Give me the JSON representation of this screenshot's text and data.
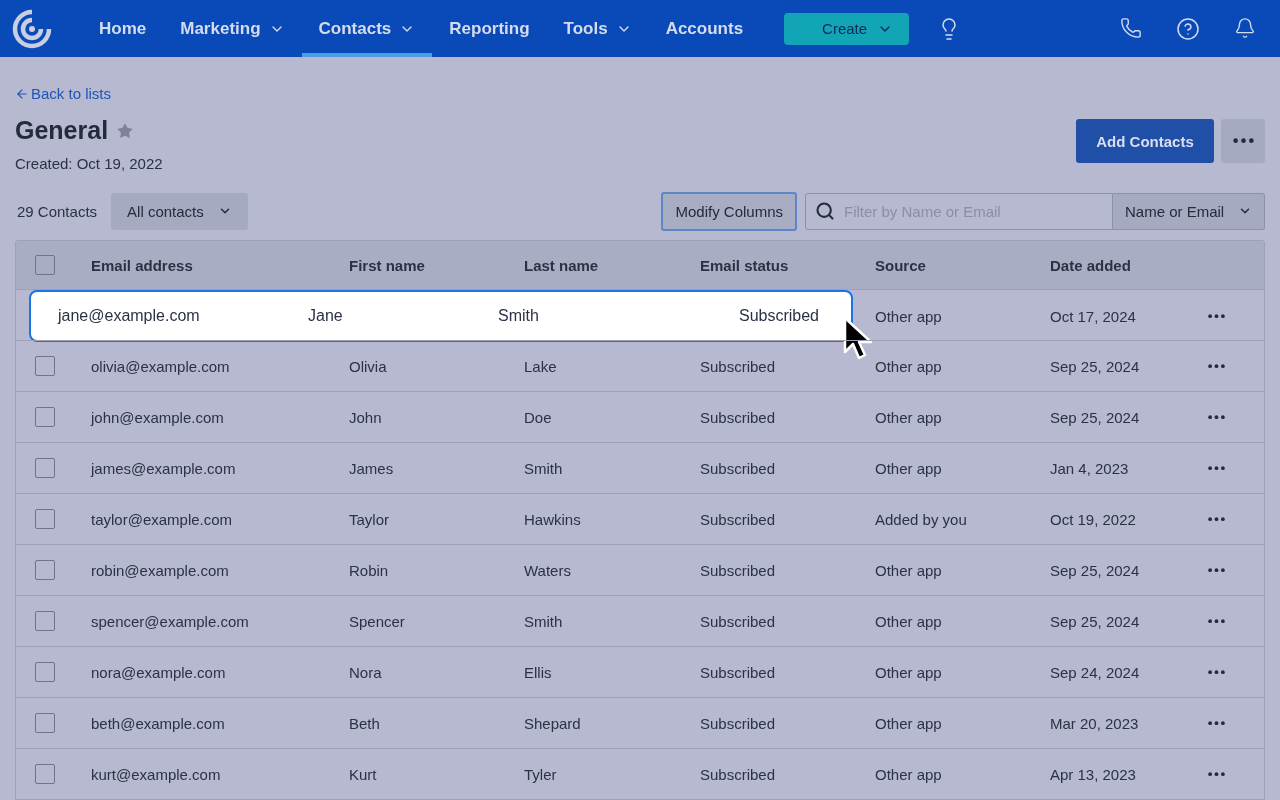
{
  "nav": {
    "items": [
      {
        "label": "Home",
        "dropdown": false,
        "selected": false
      },
      {
        "label": "Marketing",
        "dropdown": true,
        "selected": false
      },
      {
        "label": "Contacts",
        "dropdown": true,
        "selected": true
      },
      {
        "label": "Reporting",
        "dropdown": false,
        "selected": false
      },
      {
        "label": "Tools",
        "dropdown": true,
        "selected": false
      },
      {
        "label": "Accounts",
        "dropdown": false,
        "selected": false
      }
    ],
    "create_button": "Create"
  },
  "back_link": "Back to lists",
  "list": {
    "title": "General",
    "starred": false,
    "created": "Created: Oct 19, 2022"
  },
  "add_contacts_button": "Add Contacts",
  "toolbar": {
    "count": "29 Contacts",
    "segment": "All contacts",
    "modify_columns": "Modify Columns",
    "search": {
      "placeholder": "Filter by Name or Email"
    },
    "search_scope": "Name or Email"
  },
  "table": {
    "select_all_checked": false,
    "columns": [
      "Email address",
      "First name",
      "Last name",
      "Email status",
      "Source",
      "Date added"
    ],
    "rows": [
      {
        "email": "jane@example.com",
        "first": "Jane",
        "last": "Smith",
        "status": "Subscribed",
        "source": "Other app",
        "date": "Oct 17, 2024",
        "checked": false,
        "highlighted": true
      },
      {
        "email": "olivia@example.com",
        "first": "Olivia",
        "last": "Lake",
        "status": "Subscribed",
        "source": "Other app",
        "date": "Sep 25, 2024",
        "checked": false,
        "highlighted": false
      },
      {
        "email": "john@example.com",
        "first": "John",
        "last": "Doe",
        "status": "Subscribed",
        "source": "Other app",
        "date": "Sep 25, 2024",
        "checked": false,
        "highlighted": false
      },
      {
        "email": "james@example.com",
        "first": "James",
        "last": "Smith",
        "status": "Subscribed",
        "source": "Other app",
        "date": "Jan 4, 2023",
        "checked": false,
        "highlighted": false
      },
      {
        "email": "taylor@example.com",
        "first": "Taylor",
        "last": "Hawkins",
        "status": "Subscribed",
        "source": "Added by you",
        "date": "Oct 19, 2022",
        "checked": false,
        "highlighted": false
      },
      {
        "email": "robin@example.com",
        "first": "Robin",
        "last": "Waters",
        "status": "Subscribed",
        "source": "Other app",
        "date": "Sep 25, 2024",
        "checked": false,
        "highlighted": false
      },
      {
        "email": "spencer@example.com",
        "first": "Spencer",
        "last": "Smith",
        "status": "Subscribed",
        "source": "Other app",
        "date": "Sep 25, 2024",
        "checked": false,
        "highlighted": false
      },
      {
        "email": "nora@example.com",
        "first": "Nora",
        "last": "Ellis",
        "status": "Subscribed",
        "source": "Other app",
        "date": "Sep 24, 2024",
        "checked": false,
        "highlighted": false
      },
      {
        "email": "beth@example.com",
        "first": "Beth",
        "last": "Shepard",
        "status": "Subscribed",
        "source": "Other app",
        "date": "Mar 20, 2023",
        "checked": false,
        "highlighted": false
      },
      {
        "email": "kurt@example.com",
        "first": "Kurt",
        "last": "Tyler",
        "status": "Subscribed",
        "source": "Other app",
        "date": "Apr 13, 2023",
        "checked": false,
        "highlighted": false
      }
    ]
  }
}
